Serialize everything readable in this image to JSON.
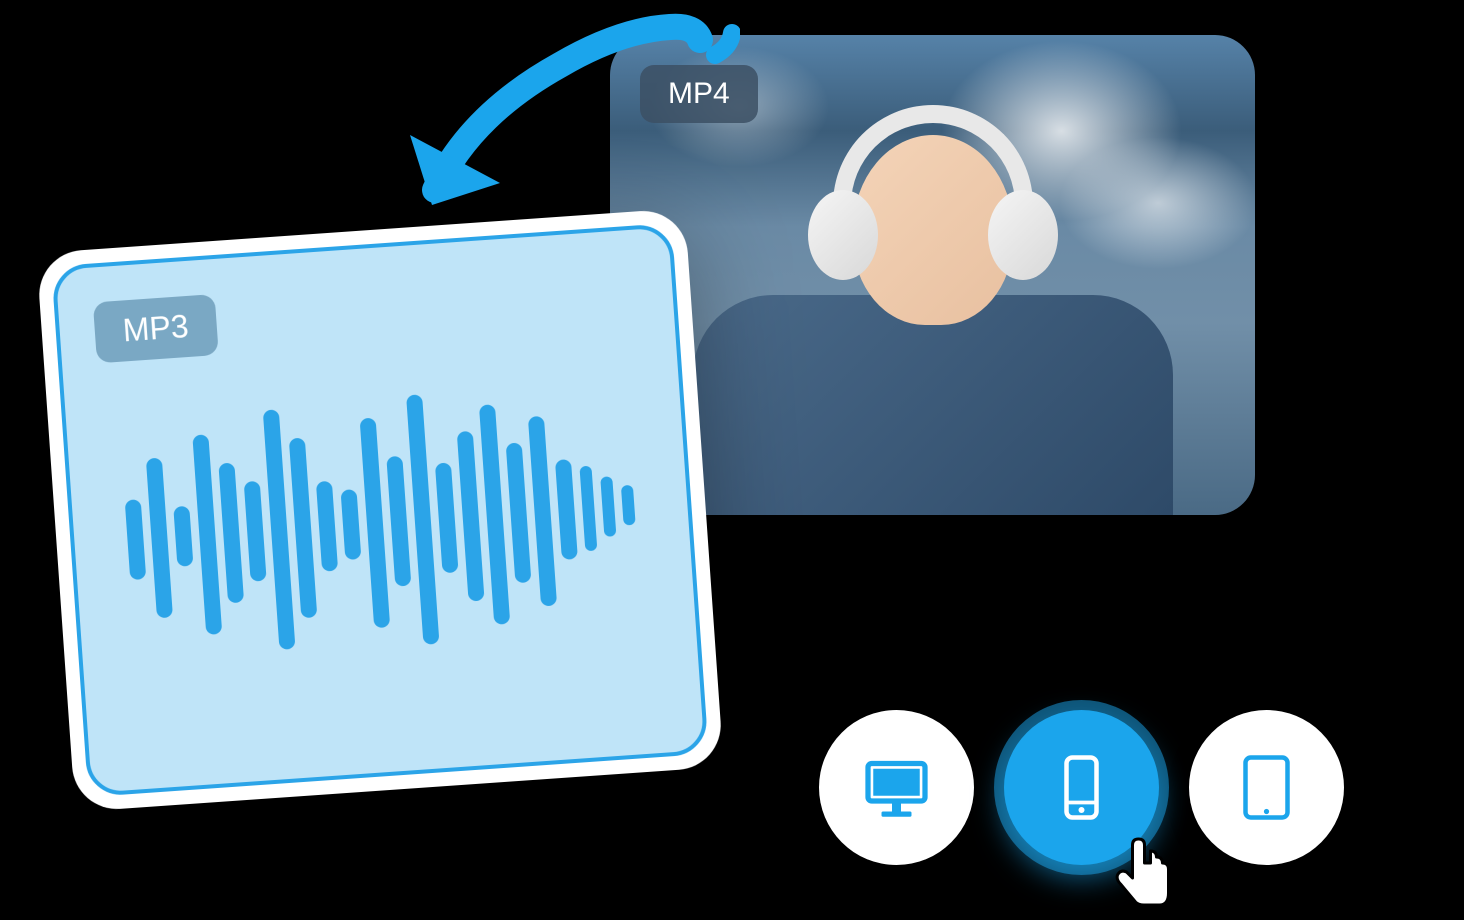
{
  "source_card": {
    "format_label": "MP4"
  },
  "target_card": {
    "format_label": "MP3",
    "waveform_heights": [
      80,
      160,
      60,
      200,
      140,
      100,
      240,
      180,
      90,
      70,
      210,
      130,
      250,
      110,
      170,
      220,
      140,
      190,
      100,
      85,
      60,
      40
    ]
  },
  "devices": {
    "desktop": {
      "name": "desktop",
      "active": false
    },
    "phone": {
      "name": "phone",
      "active": true
    },
    "tablet": {
      "name": "tablet",
      "active": false
    }
  },
  "colors": {
    "primary_blue": "#1ba5ec",
    "accent_blue": "#2ba4e8",
    "light_blue_bg": "#bfe4f8"
  }
}
